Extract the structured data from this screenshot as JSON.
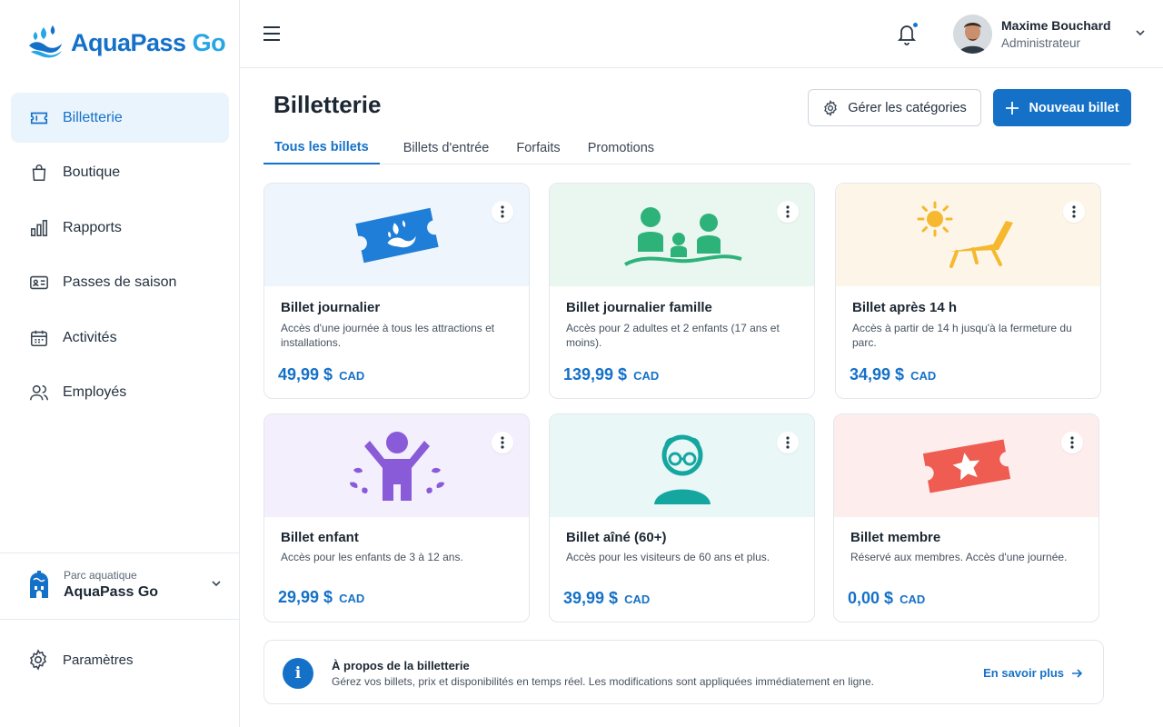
{
  "app": {
    "brand_part1": "AquaPass",
    "brand_part2": "Go",
    "accent_color": "#1571c8"
  },
  "sidebar": {
    "items": [
      {
        "label": "Billetterie",
        "icon": "ticket-icon",
        "active": true
      },
      {
        "label": "Boutique",
        "icon": "shopping-bag-icon"
      },
      {
        "label": "Rapports",
        "icon": "bar-chart-icon"
      },
      {
        "label": "Passes de saison",
        "icon": "id-card-icon"
      },
      {
        "label": "Activités",
        "icon": "calendar-icon"
      },
      {
        "label": "Employés",
        "icon": "users-icon"
      }
    ],
    "park": {
      "caption": "Parc aquatique",
      "name": "AquaPass Go"
    },
    "settings_label": "Paramètres"
  },
  "header": {
    "user_name": "Maxime Bouchard",
    "user_role": "Administrateur",
    "notifications_unread": true
  },
  "page": {
    "title": "Billetterie",
    "manage_categories_label": "Gérer les catégories",
    "new_ticket_label": "Nouveau billet"
  },
  "tabs": [
    {
      "label": "Tous les billets",
      "active": true
    },
    {
      "label": "Billets d'entrée"
    },
    {
      "label": "Forfaits"
    },
    {
      "label": "Promotions"
    }
  ],
  "tickets": [
    {
      "title": "Billet journalier",
      "description": "Accès d'une journée à tous les attractions et installations.",
      "price": "49,99 $",
      "currency": "CAD",
      "banner_color": "#eef5fd",
      "icon": "splash-ticket-icon"
    },
    {
      "title": "Billet journalier famille",
      "description": "Accès pour 2 adultes et 2 enfants (17 ans et moins).",
      "price": "139,99 $",
      "currency": "CAD",
      "banner_color": "#eaf7f0",
      "icon": "family-icon"
    },
    {
      "title": "Billet après 14 h",
      "description": "Accès à partir de 14 h jusqu'à la fermeture du parc.",
      "price": "34,99 $",
      "currency": "CAD",
      "banner_color": "#fdf6e8",
      "icon": "sun-lounger-icon"
    },
    {
      "title": "Billet enfant",
      "description": "Accès pour les enfants de 3 à 12 ans.",
      "price": "29,99 $",
      "currency": "CAD",
      "banner_color": "#f3effc",
      "icon": "child-splash-icon"
    },
    {
      "title": "Billet aîné (60+)",
      "description": "Accès pour les visiteurs de 60 ans et plus.",
      "price": "39,99 $",
      "currency": "CAD",
      "banner_color": "#e9f7f7",
      "icon": "senior-icon"
    },
    {
      "title": "Billet membre",
      "description": "Réservé aux membres. Accès d'une journée.",
      "price": "0,00 $",
      "currency": "CAD",
      "banner_color": "#fdeeed",
      "icon": "star-ticket-icon"
    }
  ],
  "info": {
    "title": "À propos de la billetterie",
    "description": "Gérez vos billets, prix et disponibilités en temps réel. Les modifications sont appliquées immédiatement en ligne.",
    "link_label": "En savoir plus"
  }
}
